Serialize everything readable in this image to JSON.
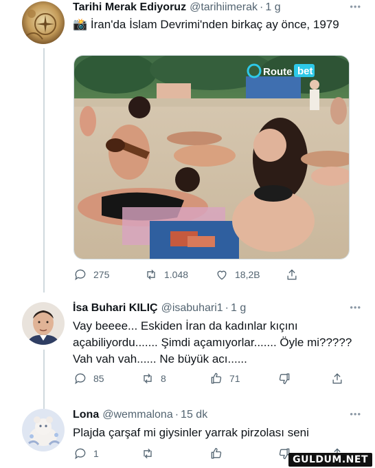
{
  "tweets": [
    {
      "name": "Tarihi Merak Ediyoruz",
      "handle": "@tarihiimerak",
      "time": "1 g",
      "text_emoji": "📸",
      "text": "İran'da İslam Devrimi'nden birkaç ay önce, 1979",
      "media": {
        "brand_text": "Route",
        "brand_badge": "bet"
      },
      "stats": {
        "replies": "275",
        "retweets": "1.048",
        "likes": "18,2B"
      }
    },
    {
      "name": "İsa Buhari KILIÇ",
      "handle": "@isabuhari1",
      "time": "1 g",
      "text": "Vay beeee... Eskiden İran da kadınlar kıçını açabiliyordu....... Şimdi açamıyorlar....... Öyle mi????? Vah vah vah...... Ne büyük acı......",
      "stats": {
        "replies": "85",
        "retweets": "8",
        "likes": "71"
      }
    },
    {
      "name": "Lona",
      "handle": "@wemmalona",
      "time": "15 dk",
      "text": "Plajda çarşaf mi giysinler yarrak pirzolası seni",
      "stats": {
        "replies": "1"
      }
    }
  ],
  "ui": {
    "dot": "·",
    "more": "•••"
  },
  "watermark": "GULDUM.NET",
  "colors": {
    "text": "#0f1419",
    "secondary": "#536471",
    "line": "#cfd9de",
    "brand_badge": "#1d9bf0"
  }
}
